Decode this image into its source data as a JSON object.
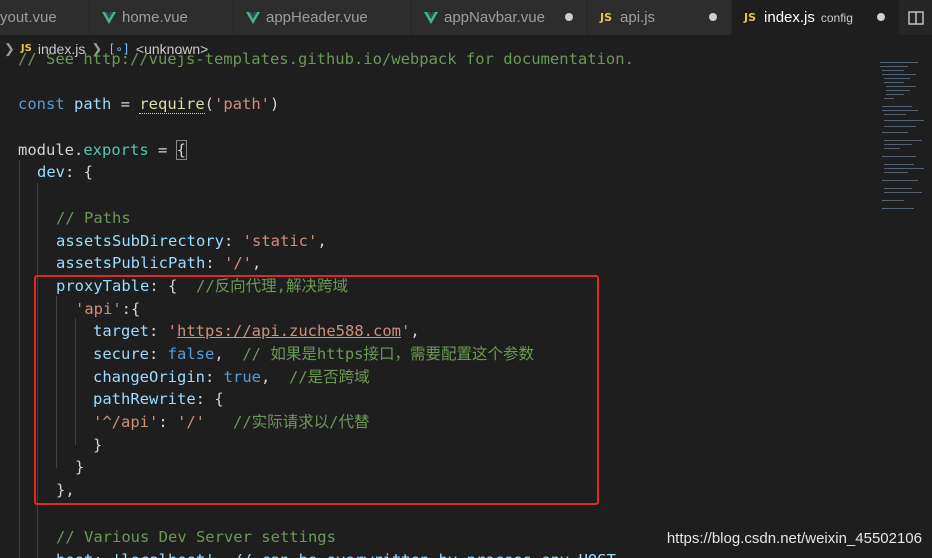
{
  "tabs": [
    {
      "label": "yout.vue",
      "icon": "vue-icon",
      "modified": false,
      "active": false
    },
    {
      "label": "home.vue",
      "icon": "vue-icon",
      "modified": false,
      "active": false
    },
    {
      "label": "appHeader.vue",
      "icon": "vue-icon",
      "modified": false,
      "active": false
    },
    {
      "label": "appNavbar.vue",
      "icon": "vue-icon",
      "modified": true,
      "active": false
    },
    {
      "label": "api.js",
      "icon": "js-icon",
      "modified": true,
      "active": false
    },
    {
      "label": "index.js",
      "description": "config",
      "icon": "js-icon",
      "modified": true,
      "active": true
    }
  ],
  "js_badge": "JS",
  "breadcrumb": {
    "file": "index.js",
    "symbol": "<unknown>"
  },
  "code": {
    "l0_comment": "// See http://vuejs-templates.github.io/webpack for documentation.",
    "l1_const": "const",
    "l1_name": "path",
    "l1_eq": " = ",
    "l1_fn": "require",
    "l1_open": "(",
    "l1_str": "'path'",
    "l1_close": ")",
    "l2_module": "module",
    "l2_dot": ".",
    "l2_exports": "exports",
    "l2_eq": " = ",
    "l2_brace": "{",
    "l3_key": "dev",
    "l3_rest": ": {",
    "l4_comment": "// Paths",
    "l5_key": "assetsSubDirectory",
    "l5_colon": ": ",
    "l5_val": "'static'",
    "l5_comma": ",",
    "l6_key": "assetsPublicPath",
    "l6_colon": ": ",
    "l6_val": "'/'",
    "l6_comma": ",",
    "l7_key": "proxyTable",
    "l7_rest": ": {  ",
    "l7_comment": "//反向代理,解决跨域",
    "l8_key": "'api'",
    "l8_rest": ":{",
    "l9_key": "target",
    "l9_colon": ": ",
    "l9_q1": "'",
    "l9_url": "https://api.zuche588.com",
    "l9_q2": "'",
    "l9_comma": ",",
    "l10_key": "secure",
    "l10_colon": ": ",
    "l10_val": "false",
    "l10_comma": ",  ",
    "l10_comment": "// 如果是https接口，需要配置这个参数",
    "l11_key": "changeOrigin",
    "l11_colon": ": ",
    "l11_val": "true",
    "l11_comma": ",  ",
    "l11_comment": "//是否跨域",
    "l12_key": "pathRewrite",
    "l12_rest": ": {",
    "l13_key": "'^/api'",
    "l13_colon": ": ",
    "l13_val": "'/'",
    "l13_comment": "   //实际请求以/代替",
    "l14": "}",
    "l15": "}",
    "l16": "},",
    "l17_comment": "// Various Dev Server settings",
    "l18_partial": "host: 'localhost', // can be overwritten by process.env.HOST"
  },
  "watermark": "https://blog.csdn.net/weixin_45502106",
  "colors": {
    "highlight_box": "#e02828",
    "vue_green": "#42b883",
    "js_yellow": "#e8c547"
  }
}
